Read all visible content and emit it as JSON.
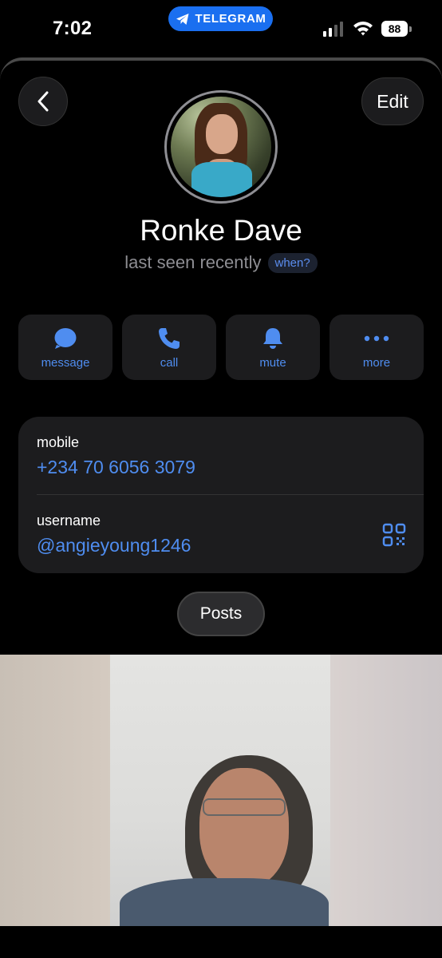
{
  "status_bar": {
    "time": "7:02",
    "app_label": "TELEGRAM",
    "battery": "88",
    "icons": [
      "telegram-icon",
      "cellular-signal-icon",
      "wifi-icon",
      "battery-icon"
    ]
  },
  "header": {
    "back_icon": "chevron-left-icon",
    "edit_label": "Edit"
  },
  "profile": {
    "name": "Ronke Dave",
    "status": "last seen recently",
    "when_label": "when?"
  },
  "actions": [
    {
      "label": "message",
      "icon": "message-bubble-icon"
    },
    {
      "label": "call",
      "icon": "phone-icon"
    },
    {
      "label": "mute",
      "icon": "bell-icon"
    },
    {
      "label": "more",
      "icon": "more-dots-icon"
    }
  ],
  "info": {
    "mobile_label": "mobile",
    "mobile_value": "+234 70 6056 3079",
    "username_label": "username",
    "username_value": "@angieyoung1246",
    "qr_icon": "qr-code-icon"
  },
  "posts_label": "Posts",
  "colors": {
    "background": "#000000",
    "card": "#1c1c1e",
    "accent": "#4f8df0",
    "telegram_pill": "#1a6ff0",
    "secondary_text": "#8e8e93"
  }
}
